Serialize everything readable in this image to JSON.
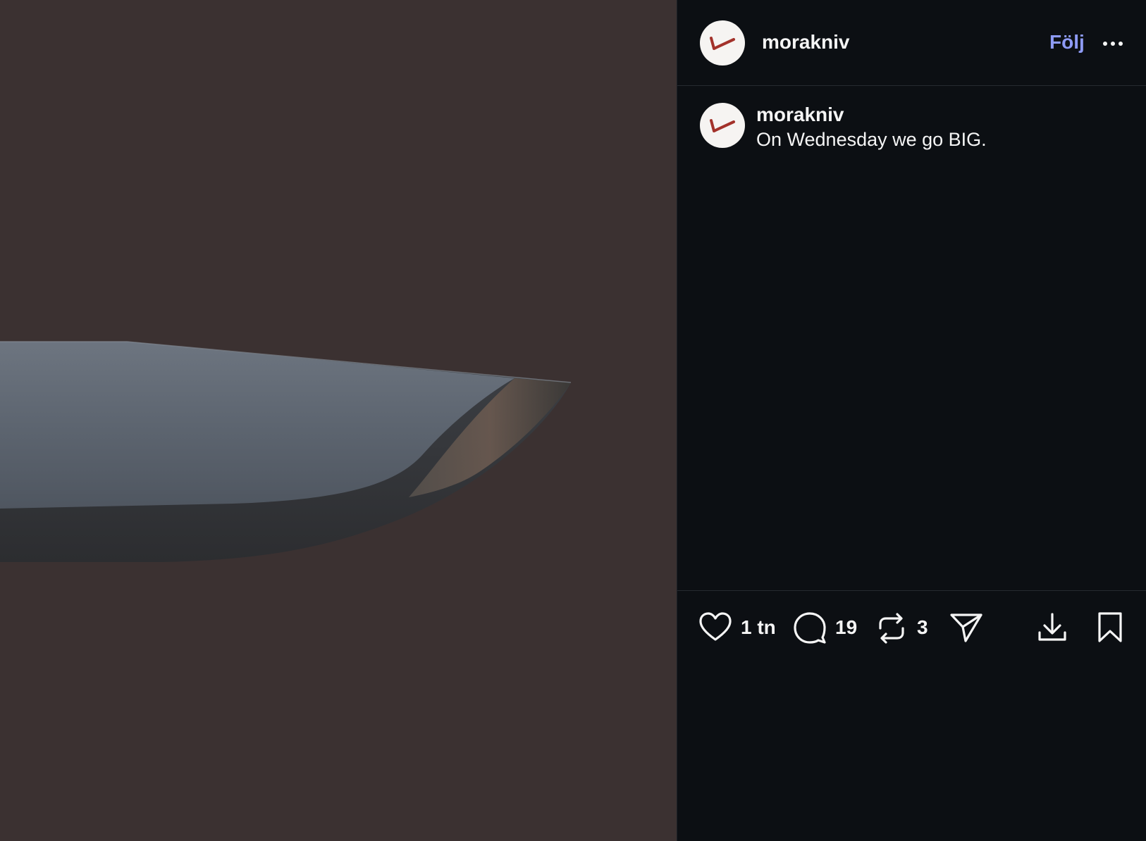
{
  "post": {
    "username": "morakniv",
    "follow_label": "Följ",
    "caption_username": "morakniv",
    "caption_text": "On Wednesday we go BIG."
  },
  "actions": {
    "likes": "1 tn",
    "comments": "19",
    "reposts": "3"
  },
  "colors": {
    "media_background": "#3b3131",
    "panel_background": "#0c0f13",
    "follow_link": "#8e9bf5",
    "logo_red": "#a3322b"
  },
  "icons": [
    "more-options-icon",
    "heart-icon",
    "comment-icon",
    "repost-icon",
    "share-icon",
    "download-icon",
    "bookmark-icon"
  ]
}
